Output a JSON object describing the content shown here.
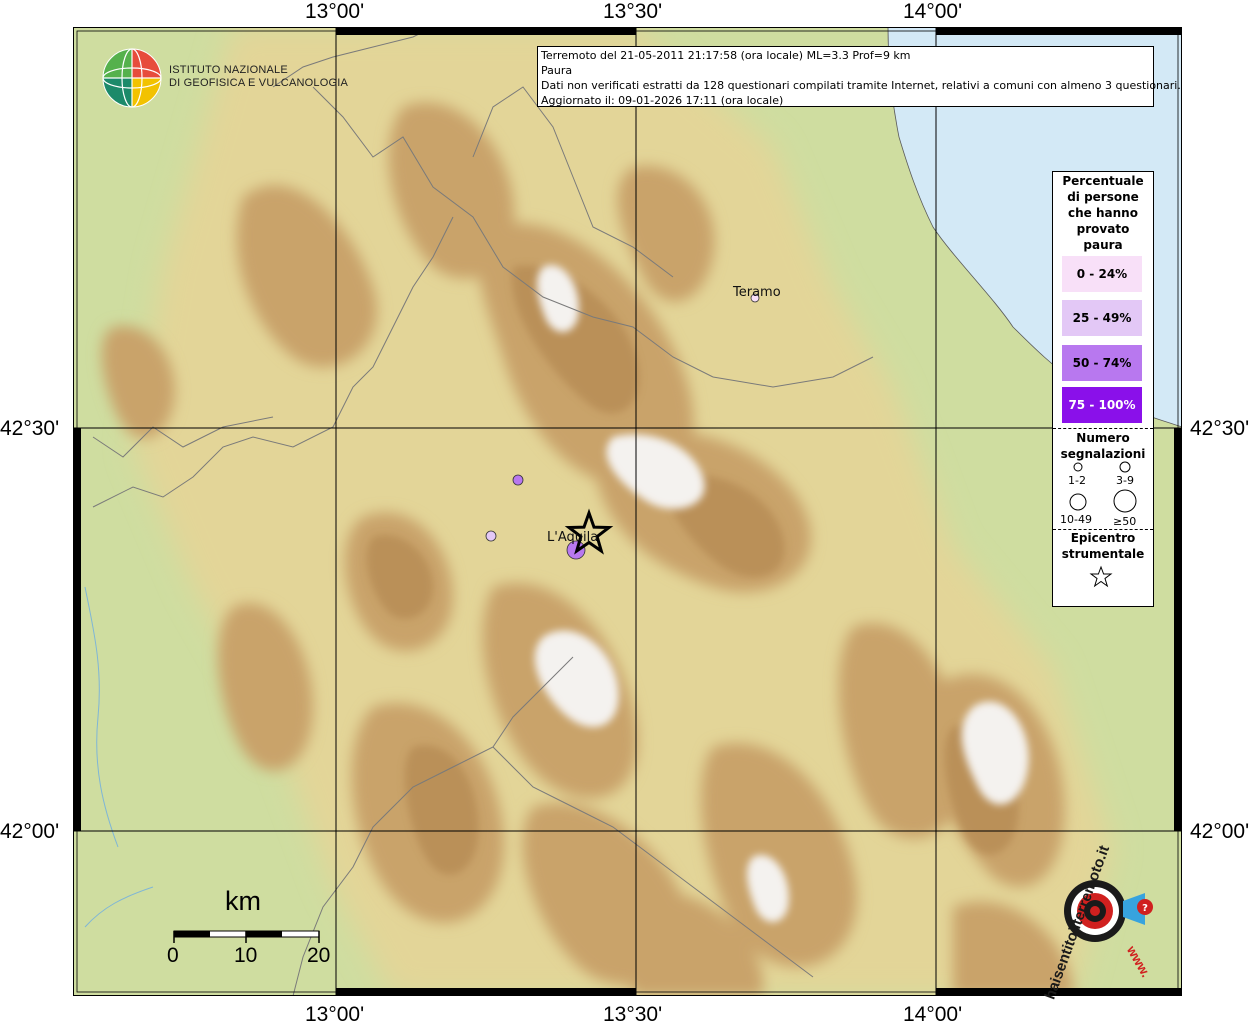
{
  "axes": {
    "top_ticks": [
      "13°00'",
      "13°30'",
      "14°00'"
    ],
    "bottom_ticks": [
      "13°00'",
      "13°30'",
      "14°00'"
    ],
    "left_ticks": [
      "42°30'",
      "42°00'"
    ],
    "right_ticks": [
      "42°30'",
      "42°00'"
    ]
  },
  "logo": {
    "line1": "ISTITUTO NAZIONALE",
    "line2": "DI GEOFISICA E VULCANOLOGIA"
  },
  "info": {
    "line1": "Terremoto del 21-05-2011 21:17:58 (ora locale) ML=3.3 Prof=9 km",
    "line2": "Paura",
    "line3": "Dati non verificati estratti da 128 questionari compilati tramite Internet, relativi a comuni con almeno 3 questionari.",
    "line4": "Aggiornato il: 09-01-2026 17:11 (ora locale)"
  },
  "places": {
    "teramo": "Teramo",
    "laquila": "L'Aquila"
  },
  "legend": {
    "title_lines": [
      "Percentuale",
      "di persone",
      "che hanno",
      "provato",
      "paura"
    ],
    "classes": [
      {
        "label": "0 - 24%",
        "color": "#f8e0f8"
      },
      {
        "label": "25 - 49%",
        "color": "#e3c8f6"
      },
      {
        "label": "50 - 74%",
        "color": "#b878ef"
      },
      {
        "label": "75 - 100%",
        "color": "#8a10ea"
      }
    ],
    "count_title_lines": [
      "Numero",
      "segnalazioni"
    ],
    "sizes": [
      "1-2",
      "3-9",
      "10-49",
      "≥50"
    ],
    "epicenter_lines": [
      "Epicentro",
      "strumentale"
    ]
  },
  "scale": {
    "unit": "km",
    "labels": [
      "0",
      "10",
      "20"
    ]
  },
  "watermark": {
    "text": "haisentitoilterremoto.it",
    "url": "www."
  },
  "colors": {
    "sea": "#d3e9f6",
    "lowland": "#cfdda0",
    "hills": "#e2d394",
    "mountains": "#c9a46a",
    "peaks": "#f3f1ee"
  }
}
